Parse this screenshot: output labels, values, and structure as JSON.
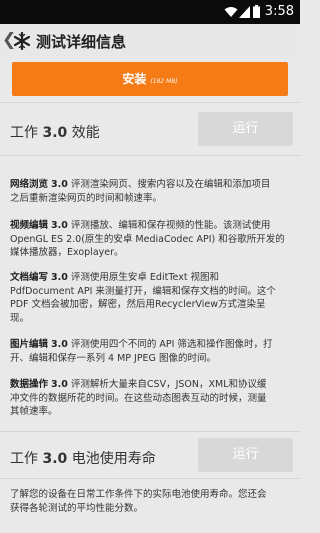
{
  "status_bar": {
    "time": "3:58",
    "icons": [
      "wifi-icon",
      "signal-icon",
      "battery-icon"
    ]
  },
  "app_bar": {
    "back_glyph": "❮",
    "title": "测试详细信息"
  },
  "install": {
    "label": "安装",
    "size": "(182 MB)"
  },
  "work_section": {
    "title_prefix": "工作 ",
    "version": "3.0",
    "title_suffix": " 效能",
    "run_label": "运行"
  },
  "tests": [
    {
      "name": "网络浏览",
      "version": "3.0",
      "lines": [
        " 评测渲染网页、搜索内容以及在编辑和添加项目",
        "之后重新渲染网页的时间和帧速率。"
      ]
    },
    {
      "name": "视频编辑",
      "version": "3.0",
      "lines": [
        " 评测播放、编辑和保存视频的性能。该测试使用",
        "OpenGL ES 2.0(原生的安卓 MediaCodec API) 和谷歌所开发的",
        "媒体播放器，Exoplayer。"
      ]
    },
    {
      "name": "文档编写",
      "version": "3.0",
      "lines": [
        " 评测使用原生安卓 EditText 视图和",
        "PdfDocument API 来测量打开，编辑和保存文档的时间。这个",
        "PDF 文档会被加密，解密，然后用RecyclerView方式渲染呈",
        "现。"
      ]
    },
    {
      "name": "图片编辑",
      "version": "3.0",
      "lines": [
        " 评测使用四个不同的 API 筛选和操作图像时，打",
        "开、编辑和保存一系列 4 MP JPEG 图像的时间。"
      ]
    },
    {
      "name": "数据操作",
      "version": "3.0",
      "lines": [
        " 评测解析大量来自CSV，JSON，XML和协议缓",
        "冲文件的数据所花的时间。在这些动态图表互动的时候，测量",
        "其帧速率。"
      ]
    }
  ],
  "battery_section": {
    "title_prefix": "工作 ",
    "version": "3.0",
    "title_suffix": " 电池使用寿命",
    "run_label": "运行",
    "desc_lines": [
      "了解您的设备在日常工作条件下的实际电池使用寿命。您还会",
      "获得各轮测试的平均性能分数。"
    ]
  },
  "colors": {
    "accent": "#f47b16",
    "disabled_button": "#d8d8d8",
    "status_bar": "#0b0b0b"
  }
}
